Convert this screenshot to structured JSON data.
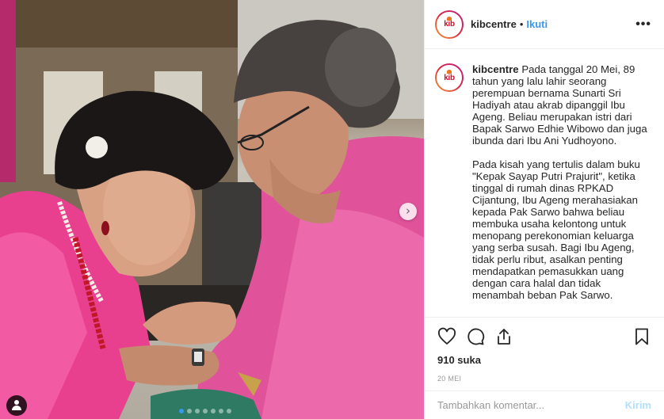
{
  "post": {
    "username": "kibcentre",
    "follow_label": "Ikuti",
    "separator": "•",
    "more_label": "•••",
    "avatar_logo_text": "kib",
    "caption_paragraphs": [
      "Pada tanggal 20 Mei, 89 tahun yang lalu lahir seorang perempuan bernama Sunarti Sri Hadiyah atau akrab dipanggil Ibu Ageng. Beliau merupakan istri dari Bapak Sarwo Edhie Wibowo dan juga ibunda dari Ibu Ani Yudhoyono.",
      "Pada kisah yang tertulis dalam buku \"Kepak Sayap Putri Prajurit\", ketika tinggal di rumah dinas RPKAD Cijantung, Ibu Ageng merahasiakan kepada Pak Sarwo bahwa beliau membuka usaha kelontong untuk menopang perekonomian keluarga yang serba susah. Bagi Ibu Ageng, tidak perlu ribut, asalkan penting mendapatkan pemasukkan uang dengan cara halal dan tidak menambah beban Pak Sarwo."
    ],
    "likes": "910 suka",
    "date": "20 MEI",
    "comment_placeholder": "Tambahkan komentar...",
    "send_label": "Kirim",
    "next_label": "›"
  },
  "colors": {
    "accent_blue": "#3897f0",
    "send_disabled": "#b2dffc",
    "brand_red": "#c8102e",
    "brand_orange": "#e87722"
  },
  "carousel": {
    "slide_count": 7,
    "active_slide": 1
  },
  "icons": {
    "like": "heart-icon",
    "comment": "comment-icon",
    "share": "share-icon",
    "save": "bookmark-icon",
    "tag": "user-tag-icon",
    "next": "chevron-right-icon"
  }
}
